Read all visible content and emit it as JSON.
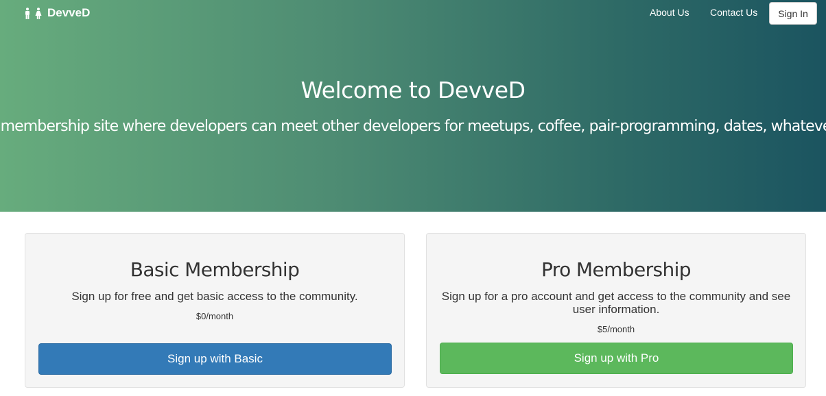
{
  "colors": {
    "hero_gradient_start": "#67ac7d",
    "hero_gradient_end": "#1b5460",
    "basic_button": "#337ab7",
    "pro_button": "#5cb85c",
    "card_background": "#f5f5f5"
  },
  "navbar": {
    "brand_icon": "male-female-icon",
    "brand_label": "DevveD",
    "links": [
      {
        "label": "About Us"
      },
      {
        "label": "Contact Us"
      }
    ],
    "signin_label": "Sign In"
  },
  "hero": {
    "title": "Welcome to DevveD",
    "subtitle": "A membership site where developers can meet other developers for meetups, coffee, pair-programming, dates, whatever."
  },
  "plans": [
    {
      "title": "Basic Membership",
      "description": "Sign up for free and get basic access to the community.",
      "price": "$0/month",
      "button_label": "Sign up with Basic"
    },
    {
      "title": "Pro Membership",
      "description": "Sign up for a pro account and get access to the community and see user information.",
      "price": "$5/month",
      "button_label": "Sign up with Pro"
    }
  ]
}
